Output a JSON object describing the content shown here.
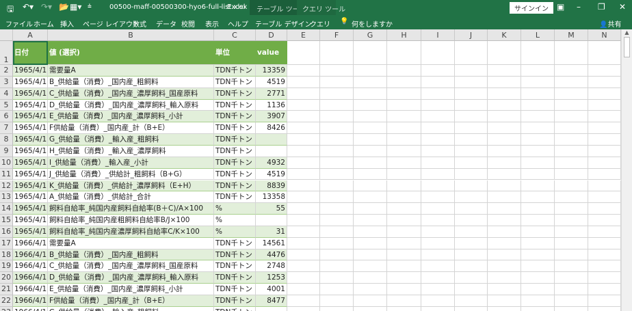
{
  "titlebar": {
    "filename": "00500-maff-00500300-hyo6-full-list.xlsx",
    "separator": "-",
    "app": "Excel",
    "context_tabs": [
      "テーブル ツール",
      "クエリ ツール"
    ],
    "signin": "サインイン"
  },
  "ribbon": {
    "tabs": [
      "ファイル",
      "ホーム",
      "挿入",
      "ページ レイアウト",
      "数式",
      "データ",
      "校閲",
      "表示",
      "ヘルプ",
      "テーブル デザイン",
      "クエリ"
    ],
    "tell_me": "何をしますか",
    "share": "共有"
  },
  "columns": [
    "A",
    "B",
    "C",
    "D",
    "E",
    "F",
    "G",
    "H",
    "I",
    "J",
    "K",
    "L",
    "M",
    "N"
  ],
  "header_row": [
    "日付",
    "値 (選択)",
    "単位",
    "value"
  ],
  "rows": [
    [
      "1965/4/1",
      "需要量A",
      "TDN千トン",
      "13359"
    ],
    [
      "1965/4/1",
      "B_供給量（消費）_国内産_粗飼料",
      "TDN千トン",
      "4519"
    ],
    [
      "1965/4/1",
      "C_供給量（消費）_国内産_濃厚飼料_国産原料",
      "TDN千トン",
      "2771"
    ],
    [
      "1965/4/1",
      "D_供給量（消費）_国内産_濃厚飼料_輸入原料",
      "TDN千トン",
      "1136"
    ],
    [
      "1965/4/1",
      "E_供給量（消費）_国内産_濃厚飼料_小計",
      "TDN千トン",
      "3907"
    ],
    [
      "1965/4/1",
      "F供給量（消費）_国内産_計（B+E）",
      "TDN千トン",
      "8426"
    ],
    [
      "1965/4/1",
      "G_供給量（消費）_輸入産_粗飼料",
      "TDN千トン",
      ""
    ],
    [
      "1965/4/1",
      "H_供給量（消費）_輸入産_濃厚飼料",
      "TDN千トン",
      ""
    ],
    [
      "1965/4/1",
      "I_供給量（消費）_輸入産_小計",
      "TDN千トン",
      "4932"
    ],
    [
      "1965/4/1",
      "J_供給量（消費）_供給計_粗飼料（B+G）",
      "TDN千トン",
      "4519"
    ],
    [
      "1965/4/1",
      "K_供給量（消費）_供給計_濃厚飼料（E+H）",
      "TDN千トン",
      "8839"
    ],
    [
      "1965/4/1",
      "A_供給量（消費）_供給計_合計",
      "TDN千トン",
      "13358"
    ],
    [
      "1965/4/1",
      "飼料自給率_純国内産飼料自給率(B＋C)/A×100",
      "%",
      "55"
    ],
    [
      "1965/4/1",
      "飼料自給率_純国内産粗飼料自給率B/J×100",
      "%",
      ""
    ],
    [
      "1965/4/1",
      "飼料自給率_純国内産濃厚飼料自給率C/K×100",
      "%",
      "31"
    ],
    [
      "1966/4/1",
      "需要量A",
      "TDN千トン",
      "14561"
    ],
    [
      "1966/4/1",
      "B_供給量（消費）_国内産_粗飼料",
      "TDN千トン",
      "4476"
    ],
    [
      "1966/4/1",
      "C_供給量（消費）_国内産_濃厚飼料_国産原料",
      "TDN千トン",
      "2748"
    ],
    [
      "1966/4/1",
      "D_供給量（消費）_国内産_濃厚飼料_輸入原料",
      "TDN千トン",
      "1253"
    ],
    [
      "1966/4/1",
      "E_供給量（消費）_国内産_濃厚飼料_小計",
      "TDN千トン",
      "4001"
    ],
    [
      "1966/4/1",
      "F供給量（消費）_国内産_計（B+E）",
      "TDN千トン",
      "8477"
    ],
    [
      "1966/4/1",
      "G_供給量（消費）_輸入産_粗飼料",
      "TDN千トン",
      ""
    ]
  ]
}
